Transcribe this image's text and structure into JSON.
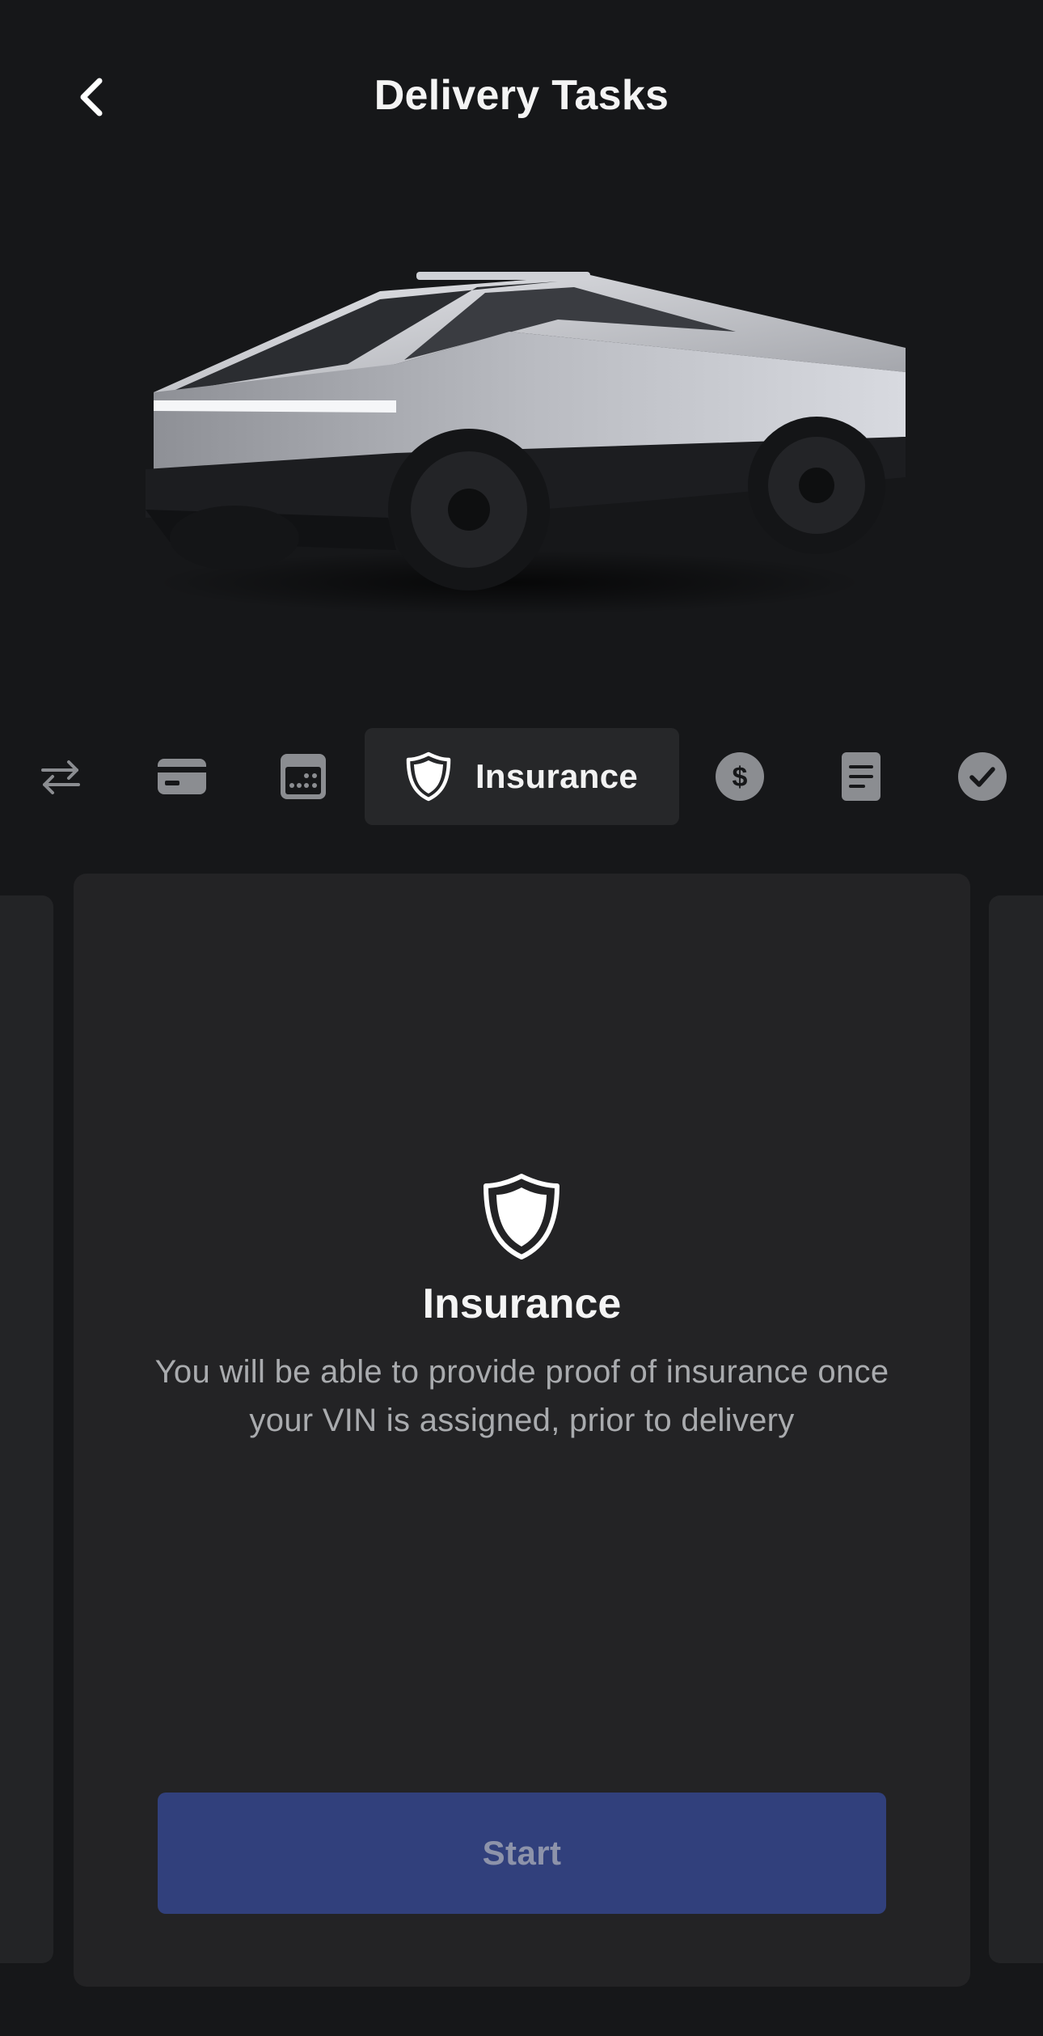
{
  "header": {
    "title": "Delivery Tasks",
    "back_icon": "chevron-left-icon"
  },
  "hero": {
    "image": "cybertruck-vehicle-render"
  },
  "steps": [
    {
      "id": "trade-in",
      "icon": "swap-arrows-icon",
      "label": ""
    },
    {
      "id": "payment",
      "icon": "credit-card-icon",
      "label": ""
    },
    {
      "id": "schedule",
      "icon": "calendar-icon",
      "label": ""
    },
    {
      "id": "insurance",
      "icon": "shield-icon",
      "label": "Insurance",
      "active": true
    },
    {
      "id": "final-payment",
      "icon": "dollar-circle-icon",
      "label": ""
    },
    {
      "id": "documents",
      "icon": "document-icon",
      "label": ""
    },
    {
      "id": "complete",
      "icon": "check-circle-icon",
      "label": ""
    }
  ],
  "card": {
    "icon": "shield-icon",
    "title": "Insurance",
    "description": "You will be able to provide proof of insurance once your VIN is assigned, prior to delivery",
    "button_label": "Start"
  },
  "colors": {
    "background": "#161719",
    "card": "#232325",
    "active_step": "#262729",
    "button": "#31407c",
    "button_text": "#8d93aa",
    "muted_text": "#a9abae",
    "icon_gray": "#8b8d91"
  }
}
